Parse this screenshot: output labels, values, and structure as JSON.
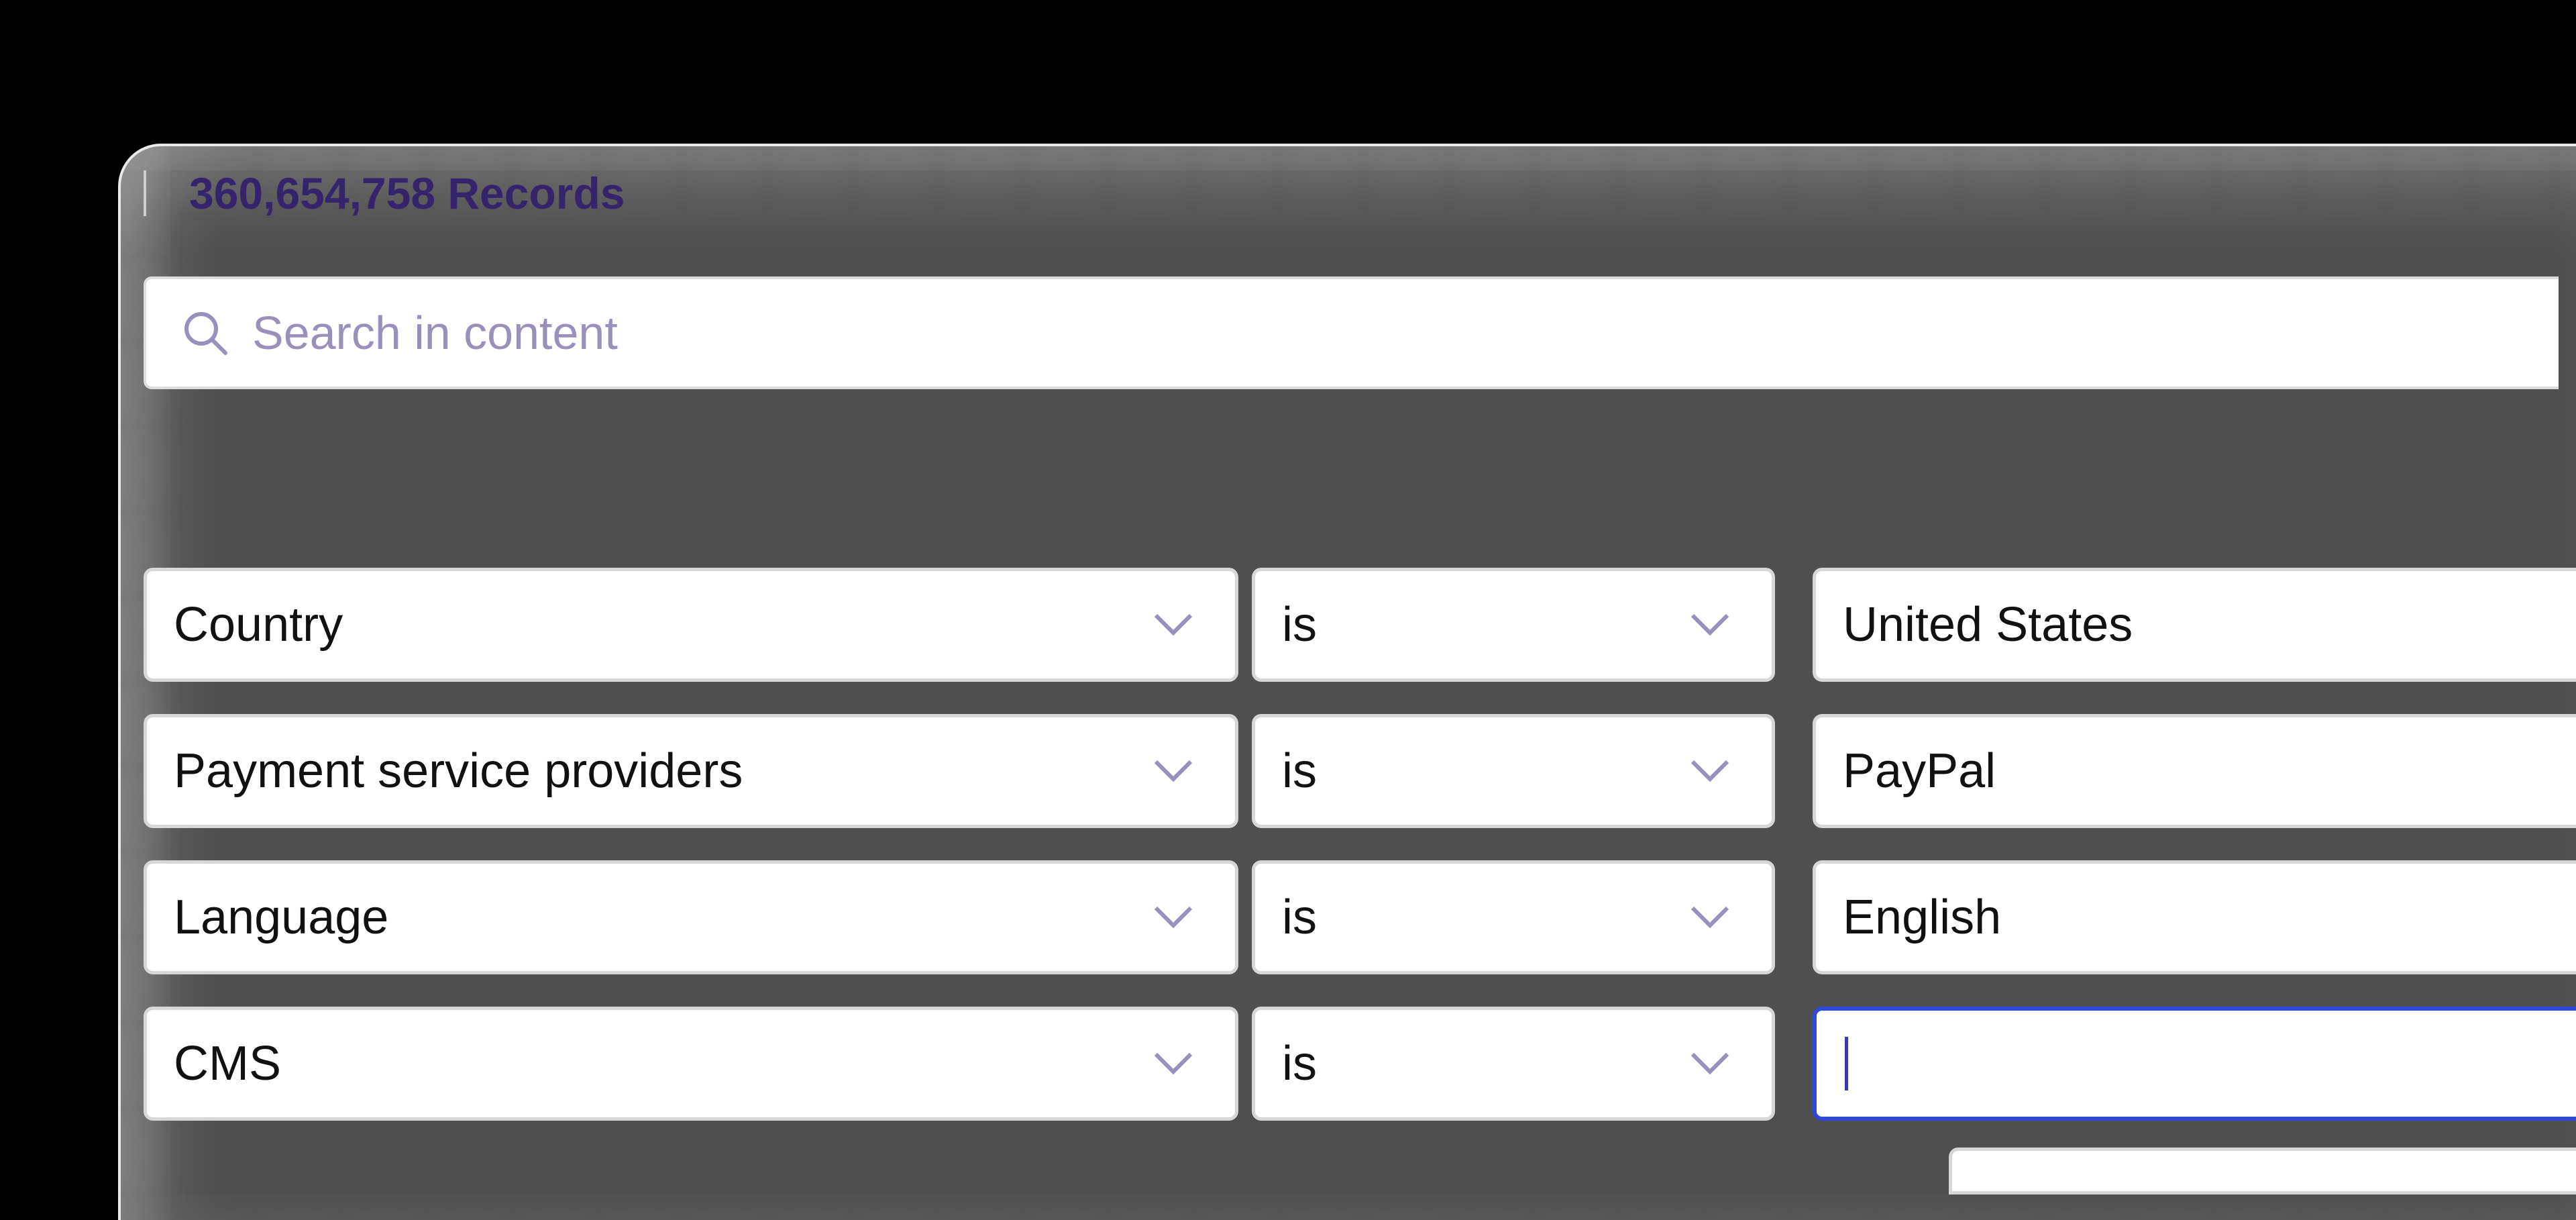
{
  "records": {
    "count_label": "360,654,758 Records"
  },
  "search": {
    "placeholder": "Search in content",
    "icon": "search-icon"
  },
  "filters": [
    {
      "attribute": "Country",
      "operator": "is",
      "value": "United States"
    },
    {
      "attribute": "Payment service providers",
      "operator": "is",
      "value": "PayPal"
    },
    {
      "attribute": "Language",
      "operator": "is",
      "value": "English"
    },
    {
      "attribute": "CMS",
      "operator": "is",
      "value": ""
    }
  ],
  "colors": {
    "accent": "#35246b",
    "placeholder": "#9b8fbc",
    "chevron": "#9a90c0",
    "focus_border": "#2d49d8",
    "panel": "#4f4f4f"
  }
}
